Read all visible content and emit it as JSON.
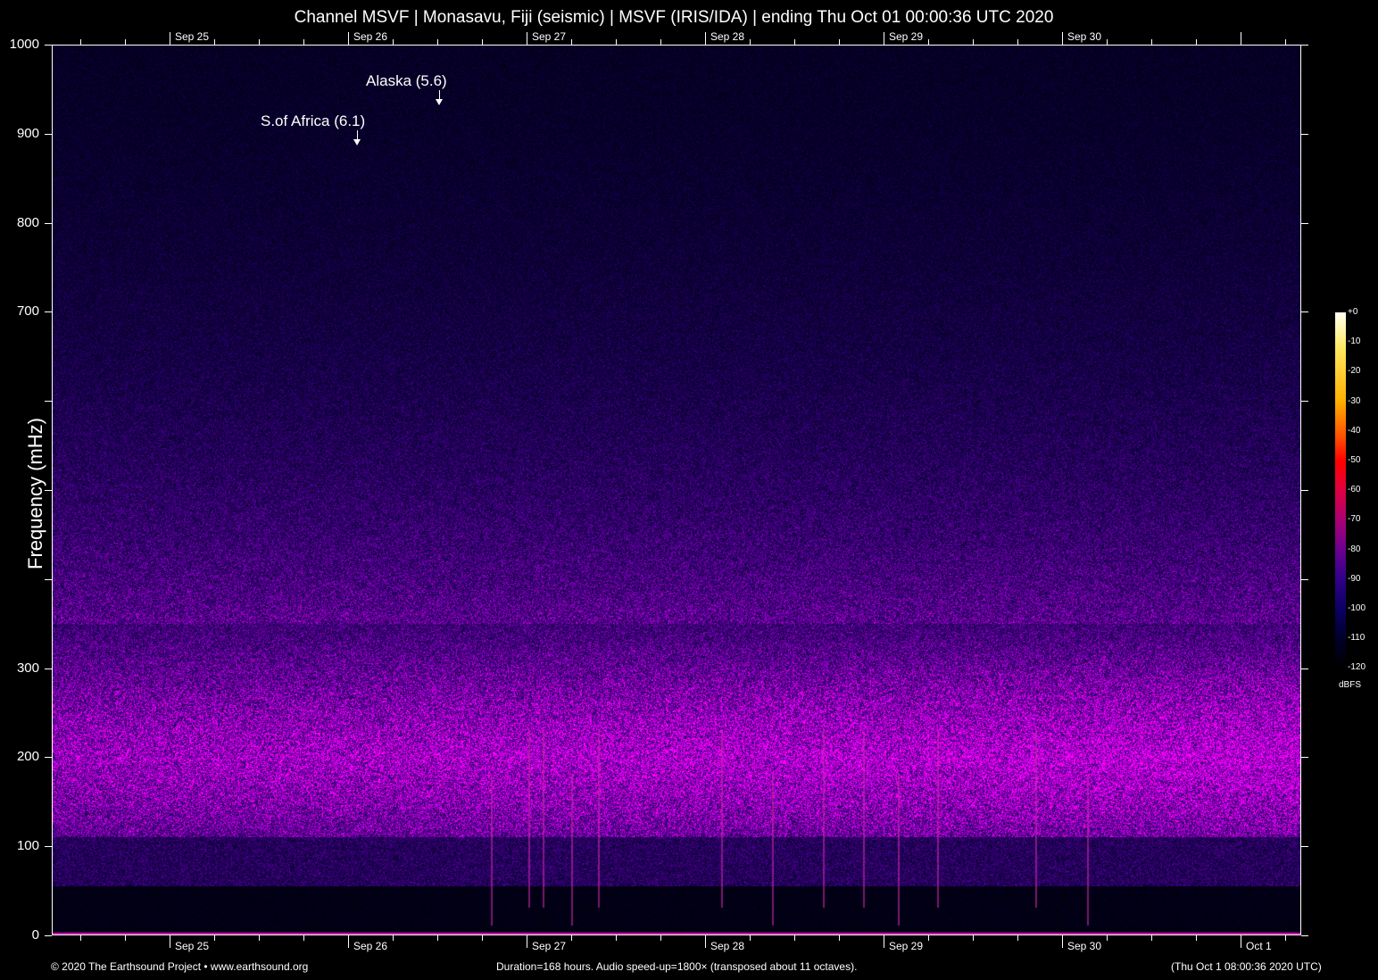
{
  "chart_data": {
    "type": "heatmap",
    "title": "Channel MSVF | Monasavu, Fiji (seismic) | MSVF (IRIS/IDA) | ending Thu Oct 01 00:00:36 UTC 2020",
    "ylabel": "Frequency (mHz)",
    "ylim": [
      0,
      1000
    ],
    "y_ticks": [
      0,
      100,
      200,
      300,
      400,
      500,
      600,
      700,
      800,
      900,
      1000
    ],
    "y_tick_labels": [
      "0",
      "100",
      "200",
      "300",
      "",
      "",
      "",
      "700",
      "800",
      "900",
      "1000"
    ],
    "x_tick_labels": [
      "Sep 25",
      "Sep 26",
      "Sep 27",
      "Sep 28",
      "Sep 29",
      "Sep 30",
      "Oct  1"
    ],
    "x_tick_days": [
      1,
      2,
      3,
      4,
      5,
      6,
      7
    ],
    "xlim_days": [
      0.34,
      7.34
    ],
    "colorbar": {
      "label": "dBFS",
      "ticks": [
        "+0",
        "-10",
        "-20",
        "-30",
        "-40",
        "-50",
        "-60",
        "-70",
        "-80",
        "-90",
        "-100",
        "-110",
        "-120"
      ],
      "range": [
        -120,
        0
      ]
    },
    "annotations": [
      {
        "label": "S.of Africa (6.1)",
        "day": 2.05,
        "freq_mHz": 890
      },
      {
        "label": "Alaska (5.6)",
        "day": 2.51,
        "freq_mHz": 935
      }
    ]
  },
  "footer": {
    "left": "© 2020 The Earthsound Project • www.earthsound.org",
    "center": "Duration=168 hours. Audio speed-up=1800× (transposed about 11 octaves).",
    "right": "(Thu Oct  1 08:00:36 2020 UTC)"
  }
}
